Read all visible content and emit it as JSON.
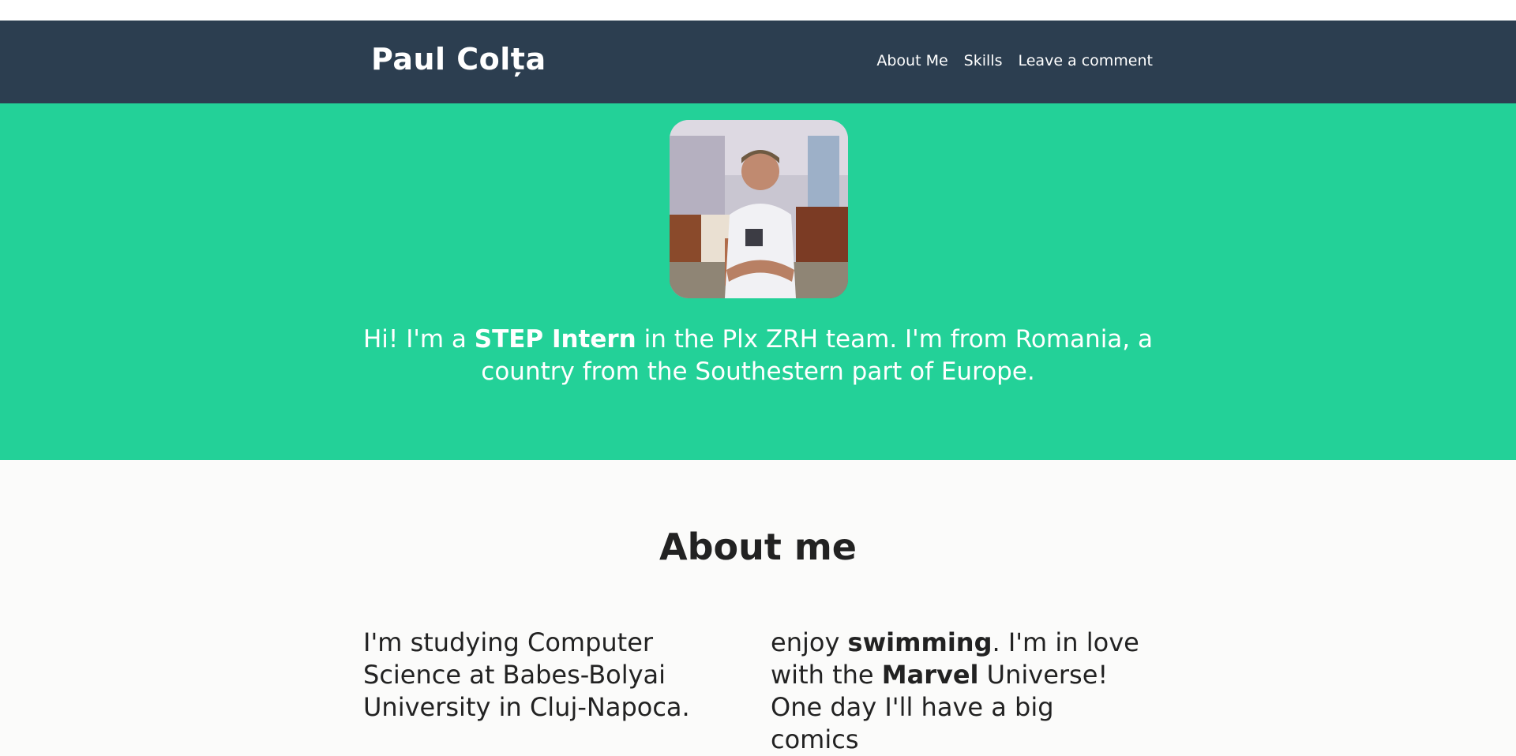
{
  "header": {
    "brand": "Paul Colța",
    "nav": [
      "About Me",
      "Skills",
      "Leave a comment"
    ]
  },
  "hero": {
    "text_before": "Hi! I'm a ",
    "text_bold": "STEP Intern",
    "text_after": " in the Plx ZRH team. I'm from Romania, a country from the Southestern part of Europe."
  },
  "about": {
    "title": "About me",
    "left_text": "I'm studying Computer Science at Babes-Bolyai University in Cluj-Napoca.",
    "right_before": "enjoy ",
    "right_bold1": "swimming",
    "right_mid": ". I'm in love with the ",
    "right_bold2": "Marvel",
    "right_after": " Universe! One day I'll have a big comics"
  },
  "colors": {
    "navbar": "#2c3e50",
    "hero": "#23d198",
    "page": "#fbfbfa",
    "text_dark": "#222222"
  }
}
